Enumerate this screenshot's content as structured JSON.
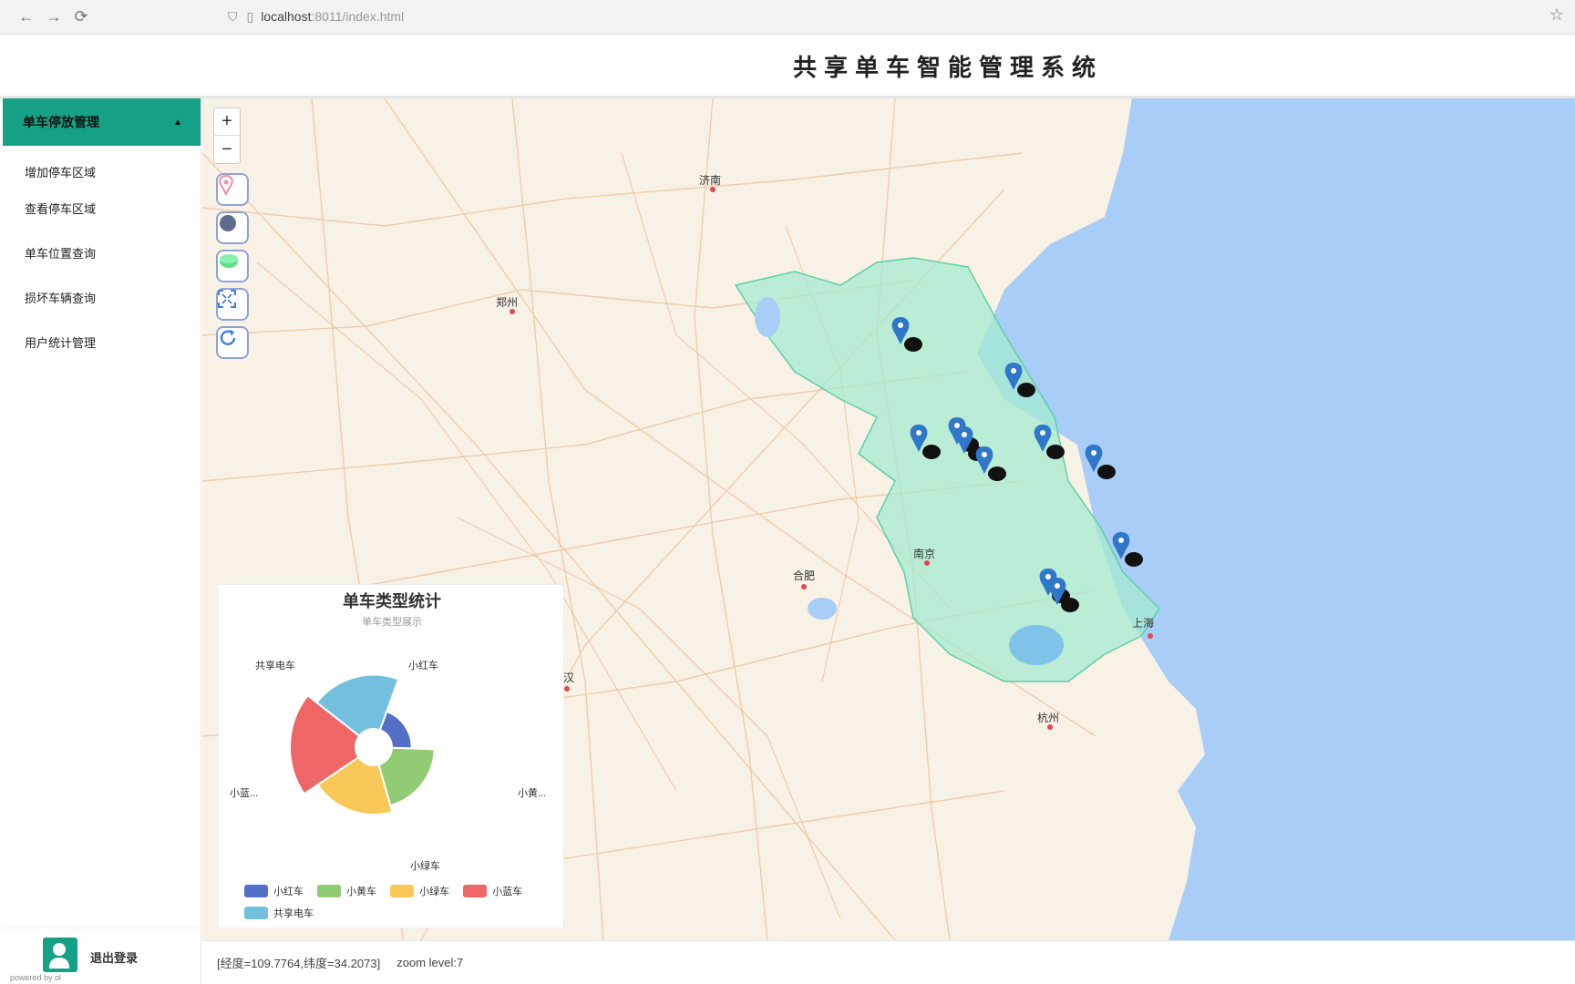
{
  "browser": {
    "back_icon": "←",
    "forward_icon": "→",
    "reload_icon": "⟳",
    "url_host": "localhost",
    "url_path": ":8011/index.html",
    "bookmark_icon": "☆"
  },
  "header": {
    "title": "共享单车智能管理系统"
  },
  "sidebar": {
    "group_label": "单车停放管理",
    "items": [
      {
        "label": "增加停车区域"
      },
      {
        "label": "查看停车区域"
      },
      {
        "label": "单车位置查询"
      },
      {
        "label": "损坏车辆查询"
      },
      {
        "label": "用户统计管理"
      }
    ],
    "footer_text": "退出登录",
    "corner_text": "powered by ol"
  },
  "map": {
    "zoom_in": "+",
    "zoom_out": "−",
    "tools": [
      {
        "icon": "location-pin-icon"
      },
      {
        "icon": "circle-draw-icon"
      },
      {
        "icon": "layer-icon"
      },
      {
        "icon": "fullscreen-icon"
      },
      {
        "icon": "refresh-icon"
      }
    ],
    "labels": [
      {
        "text": "郑州"
      },
      {
        "text": "济南"
      },
      {
        "text": "合肥"
      },
      {
        "text": "南京"
      },
      {
        "text": "上海"
      },
      {
        "text": "杭州"
      },
      {
        "text": "武汉"
      }
    ],
    "markers_count": 11
  },
  "status": {
    "coords": "[经度=109.7764,纬度=34.2073]",
    "zoom": "zoom level:7"
  },
  "chart_data": {
    "type": "pie",
    "rose": true,
    "title": "单车类型统计",
    "subtitle": "单车类型展示",
    "categories": [
      "小红车",
      "小黄车",
      "小绿车",
      "小蓝车",
      "共享电车"
    ],
    "colors": [
      "#5470c6",
      "#91cc75",
      "#fac858",
      "#ee6666",
      "#73c0de"
    ],
    "values": [
      12,
      26,
      30,
      40,
      33
    ],
    "slice_labels": [
      "小红车",
      "小黄...",
      "小绿车",
      "小蓝...",
      "共享电车"
    ]
  }
}
